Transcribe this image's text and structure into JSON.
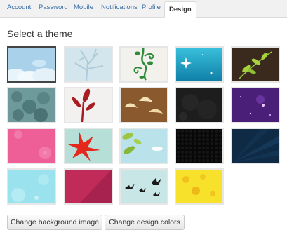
{
  "tabs": [
    {
      "label": "Account"
    },
    {
      "label": "Password"
    },
    {
      "label": "Mobile"
    },
    {
      "label": "Notifications"
    },
    {
      "label": "Profile"
    },
    {
      "label": "Design",
      "active": true
    }
  ],
  "title": "Select a theme",
  "themes": [
    {
      "name": "clouds-sky",
      "selected": true
    },
    {
      "name": "pale-branches"
    },
    {
      "name": "green-vines"
    },
    {
      "name": "teal-sparkles"
    },
    {
      "name": "leaves-on-brown"
    },
    {
      "name": "teal-foliage"
    },
    {
      "name": "red-plant"
    },
    {
      "name": "birds-on-brown"
    },
    {
      "name": "dark-grunge"
    },
    {
      "name": "purple-stars"
    },
    {
      "name": "pink-flowers"
    },
    {
      "name": "red-leaf"
    },
    {
      "name": "green-leaves-sky"
    },
    {
      "name": "black-hex-pattern"
    },
    {
      "name": "navy-rays"
    },
    {
      "name": "light-blue-bubbles"
    },
    {
      "name": "crimson-diagonal"
    },
    {
      "name": "black-birds-sky"
    },
    {
      "name": "yellow-butterflies"
    }
  ],
  "buttons": {
    "background": "Change background image",
    "colors": "Change design colors"
  }
}
